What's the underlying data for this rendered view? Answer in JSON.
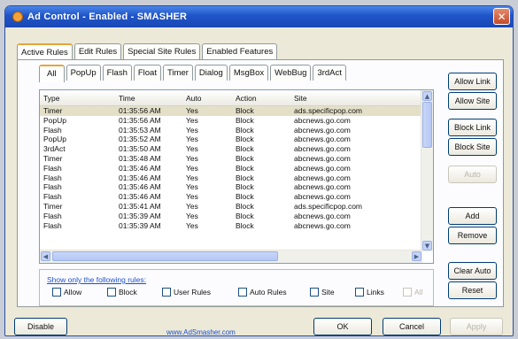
{
  "window": {
    "title": "Ad Control - Enabled - SMASHER"
  },
  "main_tabs": [
    "Active Rules",
    "Edit Rules",
    "Special Site Rules",
    "Enabled Features"
  ],
  "sub_tabs": [
    "All",
    "PopUp",
    "Flash",
    "Float",
    "Timer",
    "Dialog",
    "MsgBox",
    "WebBug",
    "3rdAct"
  ],
  "table": {
    "columns": [
      "Type",
      "Time",
      "Auto",
      "Action",
      "Site"
    ],
    "rows": [
      [
        "Timer",
        "01:35:56 AM",
        "Yes",
        "Block",
        "ads.specificpop.com"
      ],
      [
        "PopUp",
        "01:35:56 AM",
        "Yes",
        "Block",
        "abcnews.go.com"
      ],
      [
        "Flash",
        "01:35:53 AM",
        "Yes",
        "Block",
        "abcnews.go.com"
      ],
      [
        "PopUp",
        "01:35:52 AM",
        "Yes",
        "Block",
        "abcnews.go.com"
      ],
      [
        "3rdAct",
        "01:35:50 AM",
        "Yes",
        "Block",
        "abcnews.go.com"
      ],
      [
        "Timer",
        "01:35:48 AM",
        "Yes",
        "Block",
        "abcnews.go.com"
      ],
      [
        "Flash",
        "01:35:46 AM",
        "Yes",
        "Block",
        "abcnews.go.com"
      ],
      [
        "Flash",
        "01:35:46 AM",
        "Yes",
        "Block",
        "abcnews.go.com"
      ],
      [
        "Flash",
        "01:35:46 AM",
        "Yes",
        "Block",
        "abcnews.go.com"
      ],
      [
        "Flash",
        "01:35:46 AM",
        "Yes",
        "Block",
        "abcnews.go.com"
      ],
      [
        "Timer",
        "01:35:41 AM",
        "Yes",
        "Block",
        "ads.specificpop.com"
      ],
      [
        "Flash",
        "01:35:39 AM",
        "Yes",
        "Block",
        "abcnews.go.com"
      ],
      [
        "Flash",
        "01:35:39 AM",
        "Yes",
        "Block",
        "abcnews.go.com"
      ]
    ]
  },
  "side_buttons": {
    "allow_link": "Allow Link",
    "allow_site": "Allow Site",
    "block_link": "Block Link",
    "block_site": "Block Site",
    "auto": "Auto",
    "add": "Add",
    "remove": "Remove",
    "clear_auto": "Clear Auto",
    "reset": "Reset"
  },
  "filter": {
    "label": "Show only the following rules:",
    "checkboxes": [
      "Allow",
      "Block",
      "User Rules",
      "Auto Rules",
      "Site",
      "Links",
      "All"
    ]
  },
  "footer": {
    "disable": "Disable",
    "link": "www.AdSmasher.com",
    "ok": "OK",
    "cancel": "Cancel",
    "apply": "Apply"
  },
  "icons": {
    "close": "close-icon",
    "app": "app-icon"
  },
  "colors": {
    "titlebar": "#1f54c8",
    "link": "#1c4fd0",
    "active_tab_accent": "#e7a43a"
  }
}
